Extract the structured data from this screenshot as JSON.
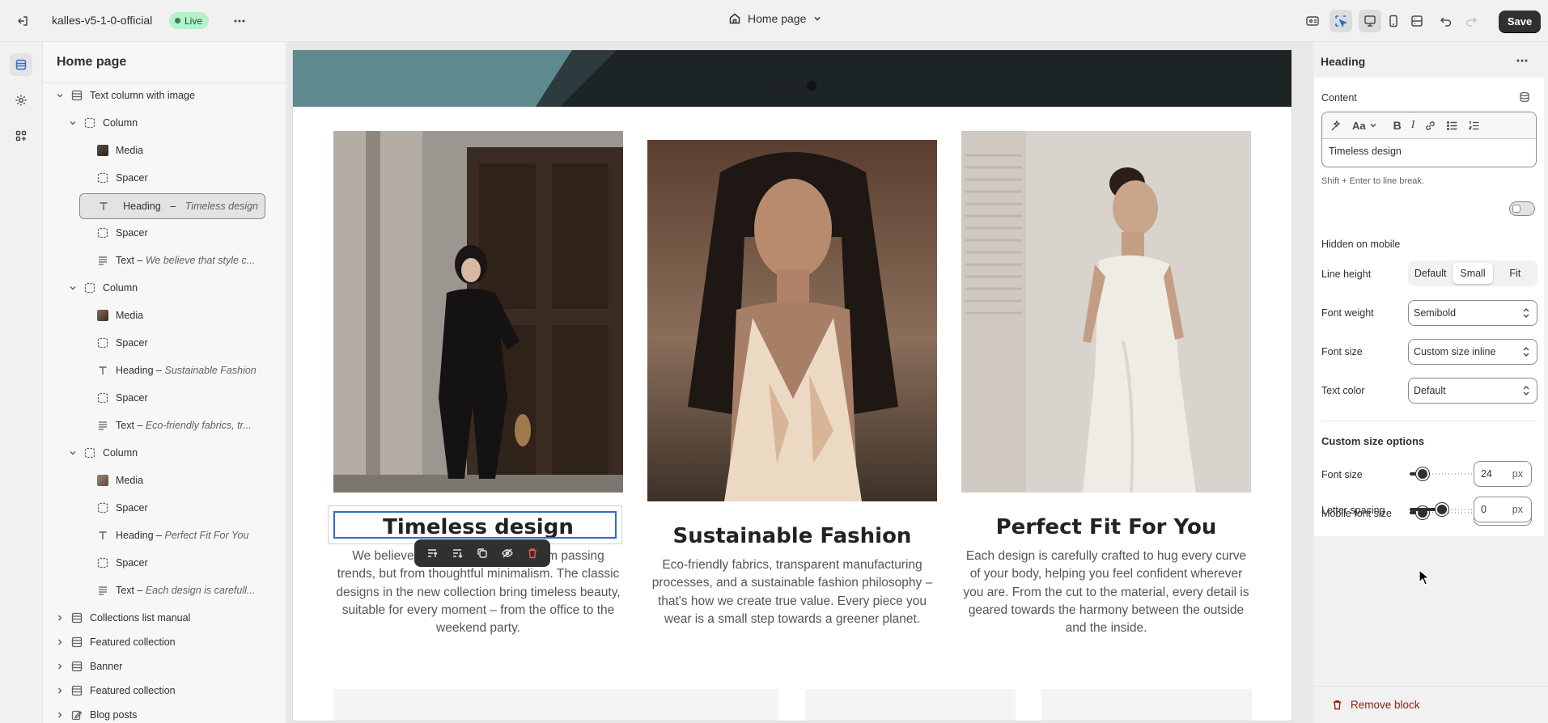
{
  "topbar": {
    "store_name": "kalles-v5-1-0-official",
    "live_badge": "Live",
    "page_selector": "Home page",
    "save_label": "Save"
  },
  "sidebar": {
    "title": "Home page",
    "items": [
      {
        "type": "section",
        "label": "Text column with image",
        "icon": "section-icon",
        "level": 0,
        "expanded": true
      },
      {
        "type": "group",
        "label": "Column",
        "level": 1,
        "expanded": true
      },
      {
        "type": "media",
        "label": "Media",
        "level": 2
      },
      {
        "type": "spacer",
        "label": "Spacer",
        "level": 2
      },
      {
        "type": "heading",
        "label": "Heading",
        "detail": "Timeless design",
        "level": 2,
        "selected": true
      },
      {
        "type": "spacer",
        "label": "Spacer",
        "level": 2
      },
      {
        "type": "text",
        "label": "Text",
        "detail": "We believe that style c...",
        "level": 2
      },
      {
        "type": "group",
        "label": "Column",
        "level": 1,
        "expanded": true
      },
      {
        "type": "media",
        "label": "Media",
        "level": 2
      },
      {
        "type": "spacer",
        "label": "Spacer",
        "level": 2
      },
      {
        "type": "heading",
        "label": "Heading",
        "detail": "Sustainable Fashion",
        "level": 2
      },
      {
        "type": "spacer",
        "label": "Spacer",
        "level": 2
      },
      {
        "type": "text",
        "label": "Text",
        "detail": "Eco-friendly fabrics, tr...",
        "level": 2
      },
      {
        "type": "group",
        "label": "Column",
        "level": 1,
        "expanded": true
      },
      {
        "type": "media",
        "label": "Media",
        "level": 2
      },
      {
        "type": "spacer",
        "label": "Spacer",
        "level": 2
      },
      {
        "type": "heading",
        "label": "Heading",
        "detail": "Perfect Fit For You",
        "level": 2
      },
      {
        "type": "spacer",
        "label": "Spacer",
        "level": 2
      },
      {
        "type": "text",
        "label": "Text",
        "detail": "Each design is carefull...",
        "level": 2
      },
      {
        "type": "section",
        "label": "Collections list manual",
        "level": 0,
        "expanded": false
      },
      {
        "type": "section",
        "label": "Featured collection",
        "level": 0,
        "expanded": false
      },
      {
        "type": "section",
        "label": "Banner",
        "level": 0,
        "expanded": false
      },
      {
        "type": "section",
        "label": "Featured collection",
        "level": 0,
        "expanded": false
      },
      {
        "type": "section",
        "label": "Blog posts",
        "level": 0,
        "expanded": false
      }
    ]
  },
  "preview": {
    "columns": [
      {
        "heading": "Timeless design",
        "text": "We believe that style comes not from passing trends, but from thoughtful minimalism. The classic designs in the new collection bring timeless beauty, suitable for every moment – from the office to the weekend party."
      },
      {
        "heading": "Sustainable Fashion",
        "text": "Eco-friendly fabrics, transparent manufacturing processes, and a sustainable fashion philosophy – that's how we create true value. Every piece you wear is a small step towards a greener planet."
      },
      {
        "heading": "Perfect Fit For You",
        "text": "Each design is carefully crafted to hug every curve of your body, helping you feel confident wherever you are. From the cut to the material, every detail is geared towards the harmony between the outside and the inside."
      }
    ]
  },
  "panel": {
    "title": "Heading",
    "content_label": "Content",
    "content_value": "Timeless design",
    "content_hint": "Shift + Enter to line break.",
    "hidden_on_mobile_label": "Hidden on mobile",
    "hidden_on_mobile": false,
    "line_height_label": "Line height",
    "line_height_options": [
      "Default",
      "Small",
      "Fit"
    ],
    "line_height_selected": "Small",
    "font_weight_label": "Font weight",
    "font_weight_value": "Semibold",
    "font_size_label": "Font size",
    "font_size_value": "Custom size inline",
    "text_color_label": "Text color",
    "text_color_value": "Default",
    "custom_section_title": "Custom size options",
    "custom_font_size_label": "Font size",
    "custom_font_size_value": "24",
    "mobile_font_size_label": "Mobile font size",
    "mobile_font_size_value": "24",
    "letter_spacing_label": "Letter spacing",
    "letter_spacing_value": "0",
    "unit": "px",
    "remove_label": "Remove block"
  },
  "colors": {
    "accent_blue": "#2c6ecb",
    "save_bg": "#303030",
    "live_bg": "#b4f0c8",
    "danger": "#8e1f0b"
  }
}
